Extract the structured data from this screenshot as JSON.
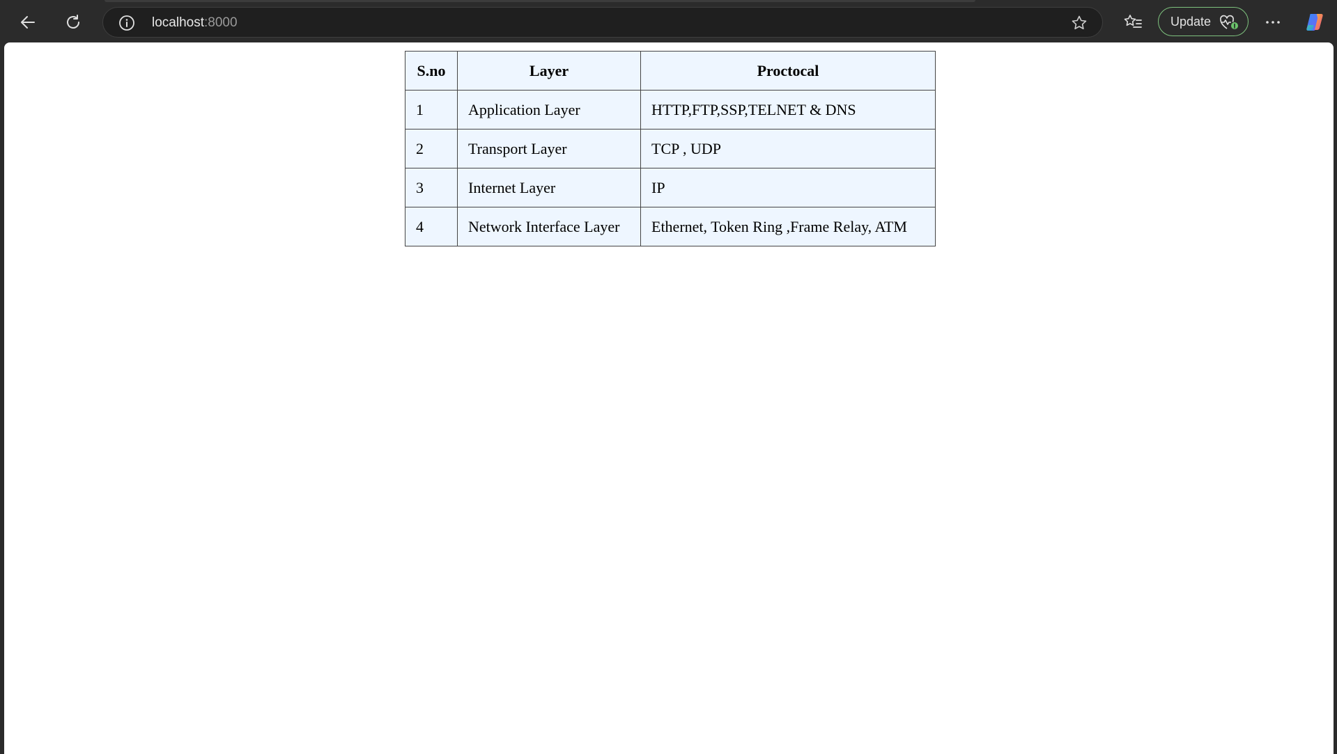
{
  "browser": {
    "address": {
      "host": "localhost",
      "port": ":8000"
    },
    "update_label": "Update"
  },
  "table": {
    "headers": [
      "S.no",
      "Layer",
      "Proctocal"
    ],
    "rows": [
      [
        "1",
        "Application Layer",
        "HTTP,FTP,SSP,TELNET & DNS"
      ],
      [
        "2",
        "Transport Layer",
        "TCP , UDP"
      ],
      [
        "3",
        "Internet Layer",
        "IP"
      ],
      [
        "4",
        "Network Interface Layer",
        "Ethernet, Token Ring ,Frame Relay, ATM"
      ]
    ]
  },
  "colors": {
    "chrome_bg": "#2b2b2b",
    "cell_bg": "#eef6ff",
    "update_border": "#7ec27e"
  },
  "icons": [
    "back-arrow-icon",
    "refresh-icon",
    "info-icon",
    "star-icon",
    "favorites-icon",
    "health-icon",
    "more-icon",
    "copilot-icon"
  ]
}
